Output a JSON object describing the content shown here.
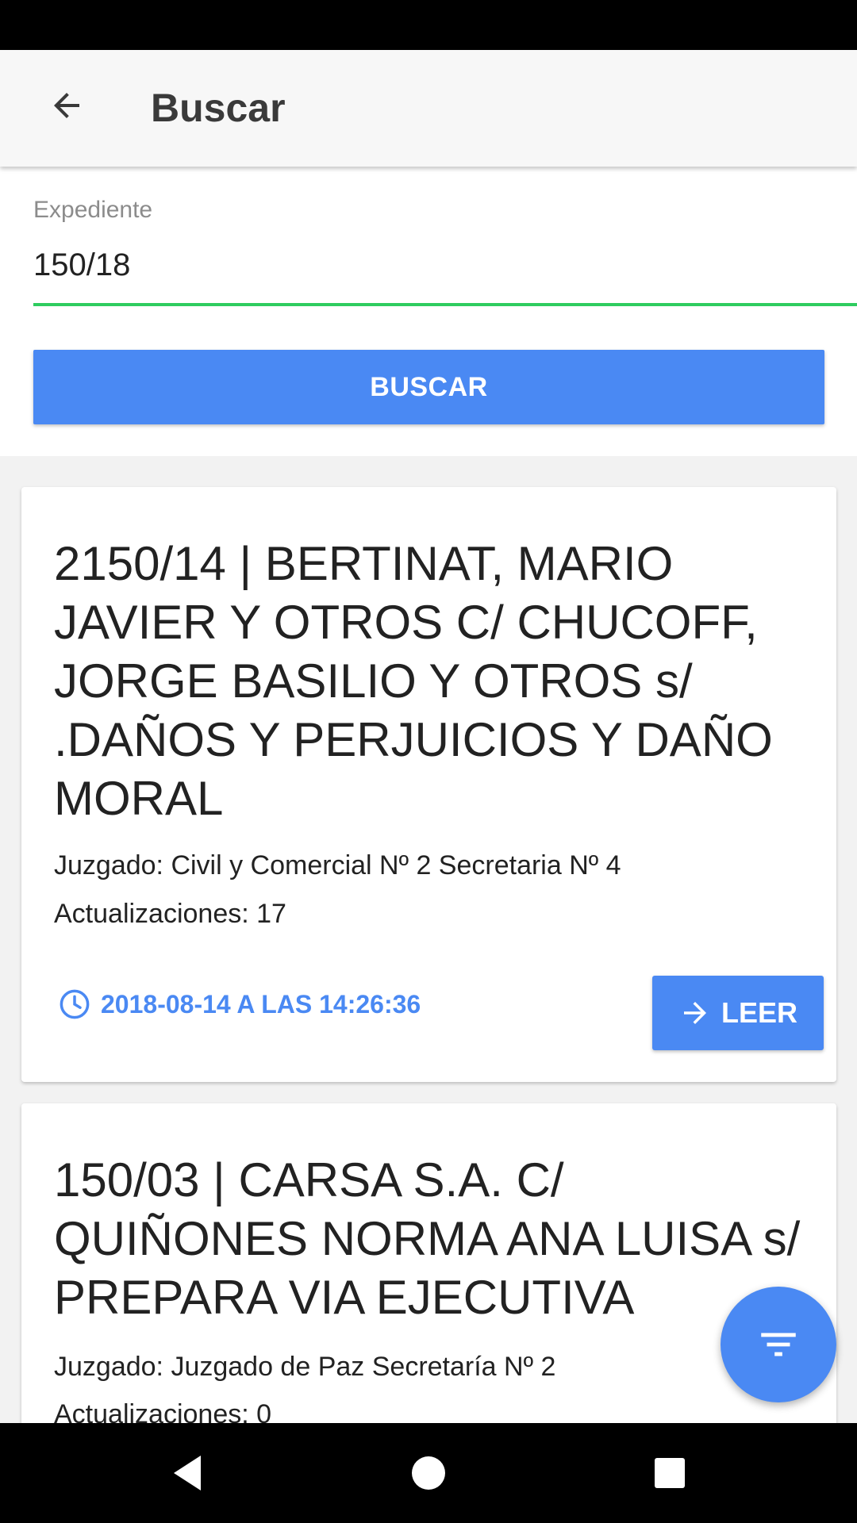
{
  "app_bar": {
    "back_icon": "arrow-back-icon",
    "title": "Buscar"
  },
  "form": {
    "field_label": "Expediente",
    "field_value": "150/18",
    "search_button": "BUSCAR",
    "accent_color": "#2ecc5f",
    "primary_color": "#4a89f3"
  },
  "results": [
    {
      "title": "2150/14 | BERTINAT, MARIO JAVIER Y OTROS C/ CHUCOFF, JORGE BASILIO Y OTROS s/ .DAÑOS Y PERJUICIOS Y DAÑO MORAL",
      "court": "Juzgado: Civil y Comercial Nº 2 Secretaria Nº 4",
      "updates": "Actualizaciones: 17",
      "date": "2018-08-14 A LAS 14:26:36",
      "date_icon": "clock-icon",
      "read_button": "LEER",
      "read_icon": "arrow-forward-icon"
    },
    {
      "title": "150/03 | CARSA S.A. C/ QUIÑONES NORMA ANA LUISA s/ PREPARA VIA EJECUTIVA",
      "court": "Juzgado: Juzgado de Paz Secretaría Nº 2",
      "updates": "Actualizaciones: 0"
    }
  ],
  "fab": {
    "icon": "filter-icon"
  },
  "system_nav": {
    "back": "nav-back-icon",
    "home": "nav-home-icon",
    "recents": "nav-recents-icon"
  }
}
